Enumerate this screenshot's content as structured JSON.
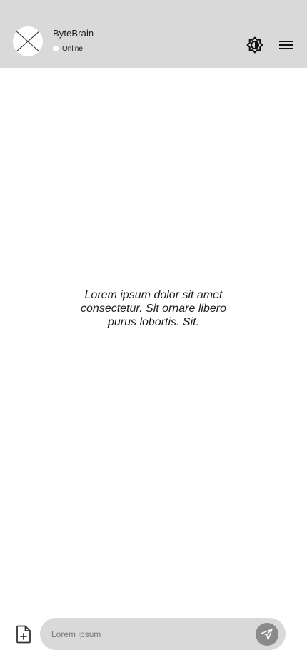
{
  "header": {
    "bot_name": "ByteBrain",
    "status_label": "Online",
    "theme_icon": "brightness-icon",
    "menu_icon": "hamburger-menu-icon"
  },
  "main": {
    "placeholder_text": "Lorem ipsum dolor sit amet consectetur. Sit ornare libero purus lobortis. Sit."
  },
  "composer": {
    "attach_icon": "file-add-icon",
    "input_placeholder": "Lorem ipsum",
    "input_value": "",
    "send_icon": "send-icon"
  },
  "colors": {
    "header_bg": "#d9d9d9",
    "input_bg": "#d9d9d9",
    "send_button_bg": "#8a8a8a",
    "status_dot": "#ffffff"
  }
}
